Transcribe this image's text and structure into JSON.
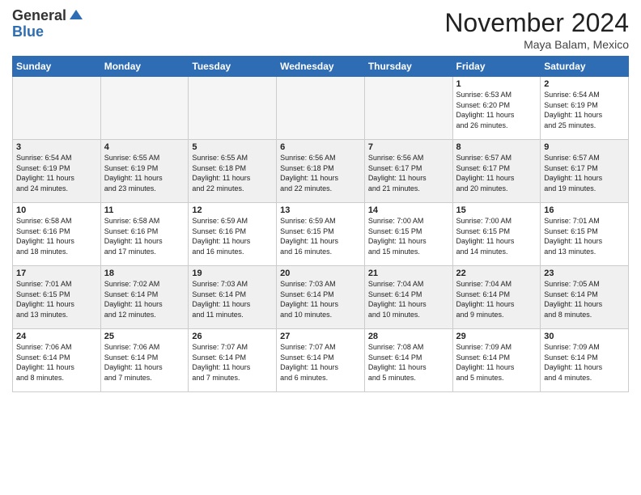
{
  "logo": {
    "general": "General",
    "blue": "Blue"
  },
  "title": "November 2024",
  "location": "Maya Balam, Mexico",
  "days_of_week": [
    "Sunday",
    "Monday",
    "Tuesday",
    "Wednesday",
    "Thursday",
    "Friday",
    "Saturday"
  ],
  "weeks": [
    [
      {
        "day": "",
        "detail": "",
        "empty": true
      },
      {
        "day": "",
        "detail": "",
        "empty": true
      },
      {
        "day": "",
        "detail": "",
        "empty": true
      },
      {
        "day": "",
        "detail": "",
        "empty": true
      },
      {
        "day": "",
        "detail": "",
        "empty": true
      },
      {
        "day": "1",
        "detail": "Sunrise: 6:53 AM\nSunset: 6:20 PM\nDaylight: 11 hours\nand 26 minutes."
      },
      {
        "day": "2",
        "detail": "Sunrise: 6:54 AM\nSunset: 6:19 PM\nDaylight: 11 hours\nand 25 minutes."
      }
    ],
    [
      {
        "day": "3",
        "detail": "Sunrise: 6:54 AM\nSunset: 6:19 PM\nDaylight: 11 hours\nand 24 minutes."
      },
      {
        "day": "4",
        "detail": "Sunrise: 6:55 AM\nSunset: 6:19 PM\nDaylight: 11 hours\nand 23 minutes."
      },
      {
        "day": "5",
        "detail": "Sunrise: 6:55 AM\nSunset: 6:18 PM\nDaylight: 11 hours\nand 22 minutes."
      },
      {
        "day": "6",
        "detail": "Sunrise: 6:56 AM\nSunset: 6:18 PM\nDaylight: 11 hours\nand 22 minutes."
      },
      {
        "day": "7",
        "detail": "Sunrise: 6:56 AM\nSunset: 6:17 PM\nDaylight: 11 hours\nand 21 minutes."
      },
      {
        "day": "8",
        "detail": "Sunrise: 6:57 AM\nSunset: 6:17 PM\nDaylight: 11 hours\nand 20 minutes."
      },
      {
        "day": "9",
        "detail": "Sunrise: 6:57 AM\nSunset: 6:17 PM\nDaylight: 11 hours\nand 19 minutes."
      }
    ],
    [
      {
        "day": "10",
        "detail": "Sunrise: 6:58 AM\nSunset: 6:16 PM\nDaylight: 11 hours\nand 18 minutes."
      },
      {
        "day": "11",
        "detail": "Sunrise: 6:58 AM\nSunset: 6:16 PM\nDaylight: 11 hours\nand 17 minutes."
      },
      {
        "day": "12",
        "detail": "Sunrise: 6:59 AM\nSunset: 6:16 PM\nDaylight: 11 hours\nand 16 minutes."
      },
      {
        "day": "13",
        "detail": "Sunrise: 6:59 AM\nSunset: 6:15 PM\nDaylight: 11 hours\nand 16 minutes."
      },
      {
        "day": "14",
        "detail": "Sunrise: 7:00 AM\nSunset: 6:15 PM\nDaylight: 11 hours\nand 15 minutes."
      },
      {
        "day": "15",
        "detail": "Sunrise: 7:00 AM\nSunset: 6:15 PM\nDaylight: 11 hours\nand 14 minutes."
      },
      {
        "day": "16",
        "detail": "Sunrise: 7:01 AM\nSunset: 6:15 PM\nDaylight: 11 hours\nand 13 minutes."
      }
    ],
    [
      {
        "day": "17",
        "detail": "Sunrise: 7:01 AM\nSunset: 6:15 PM\nDaylight: 11 hours\nand 13 minutes."
      },
      {
        "day": "18",
        "detail": "Sunrise: 7:02 AM\nSunset: 6:14 PM\nDaylight: 11 hours\nand 12 minutes."
      },
      {
        "day": "19",
        "detail": "Sunrise: 7:03 AM\nSunset: 6:14 PM\nDaylight: 11 hours\nand 11 minutes."
      },
      {
        "day": "20",
        "detail": "Sunrise: 7:03 AM\nSunset: 6:14 PM\nDaylight: 11 hours\nand 10 minutes."
      },
      {
        "day": "21",
        "detail": "Sunrise: 7:04 AM\nSunset: 6:14 PM\nDaylight: 11 hours\nand 10 minutes."
      },
      {
        "day": "22",
        "detail": "Sunrise: 7:04 AM\nSunset: 6:14 PM\nDaylight: 11 hours\nand 9 minutes."
      },
      {
        "day": "23",
        "detail": "Sunrise: 7:05 AM\nSunset: 6:14 PM\nDaylight: 11 hours\nand 8 minutes."
      }
    ],
    [
      {
        "day": "24",
        "detail": "Sunrise: 7:06 AM\nSunset: 6:14 PM\nDaylight: 11 hours\nand 8 minutes."
      },
      {
        "day": "25",
        "detail": "Sunrise: 7:06 AM\nSunset: 6:14 PM\nDaylight: 11 hours\nand 7 minutes."
      },
      {
        "day": "26",
        "detail": "Sunrise: 7:07 AM\nSunset: 6:14 PM\nDaylight: 11 hours\nand 7 minutes."
      },
      {
        "day": "27",
        "detail": "Sunrise: 7:07 AM\nSunset: 6:14 PM\nDaylight: 11 hours\nand 6 minutes."
      },
      {
        "day": "28",
        "detail": "Sunrise: 7:08 AM\nSunset: 6:14 PM\nDaylight: 11 hours\nand 5 minutes."
      },
      {
        "day": "29",
        "detail": "Sunrise: 7:09 AM\nSunset: 6:14 PM\nDaylight: 11 hours\nand 5 minutes."
      },
      {
        "day": "30",
        "detail": "Sunrise: 7:09 AM\nSunset: 6:14 PM\nDaylight: 11 hours\nand 4 minutes."
      }
    ]
  ]
}
